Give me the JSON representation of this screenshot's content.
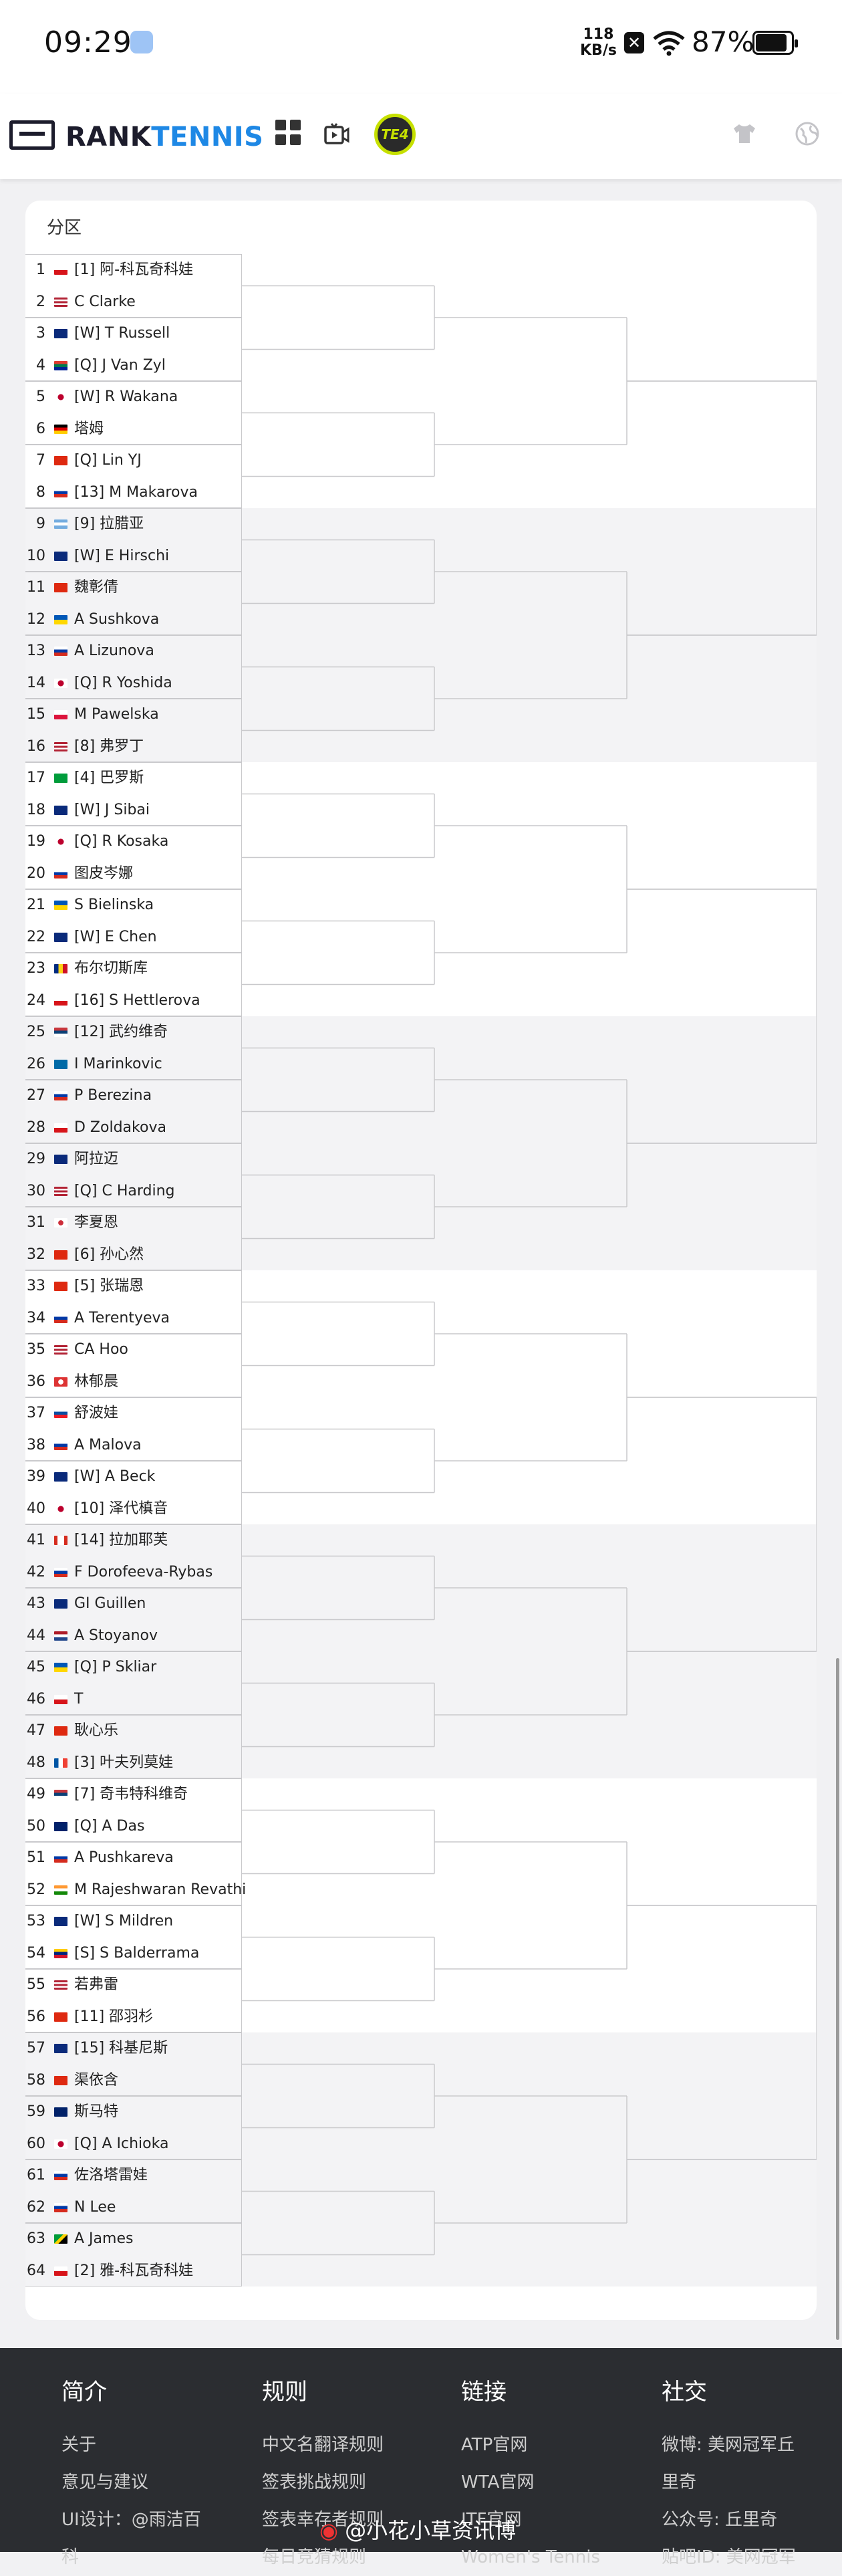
{
  "status_bar": {
    "time": "09:29",
    "net_speed": "118",
    "net_unit": "KB/s",
    "battery": "87%"
  },
  "header": {
    "logo_part1": "RANK",
    "logo_part2": "TENNIS",
    "badge": "TE4",
    "icons": [
      "draw-icon",
      "video-icon",
      "shirt-icon",
      "globe-icon"
    ]
  },
  "draw": {
    "section_label": "分区",
    "players": [
      {
        "num": "1",
        "flag": "cz",
        "name": "[1] 阿-科瓦奇科娃"
      },
      {
        "num": "2",
        "flag": "us",
        "name": "C Clarke"
      },
      {
        "num": "3",
        "flag": "au",
        "name": "[W] T Russell"
      },
      {
        "num": "4",
        "flag": "za",
        "name": "[Q] J Van Zyl"
      },
      {
        "num": "5",
        "flag": "jp",
        "name": "[W] R Wakana"
      },
      {
        "num": "6",
        "flag": "de",
        "name": "塔姆"
      },
      {
        "num": "7",
        "flag": "cn",
        "name": "[Q] Lin YJ"
      },
      {
        "num": "8",
        "flag": "ru",
        "name": "[13] M Makarova"
      },
      {
        "num": "9",
        "flag": "ar",
        "name": "[9] 拉腊亚"
      },
      {
        "num": "10",
        "flag": "au",
        "name": "[W] E Hirschi"
      },
      {
        "num": "11",
        "flag": "cn",
        "name": "魏彰倩"
      },
      {
        "num": "12",
        "flag": "ua",
        "name": "A Sushkova"
      },
      {
        "num": "13",
        "flag": "ru",
        "name": "A Lizunova"
      },
      {
        "num": "14",
        "flag": "jp",
        "name": "[Q] R Yoshida"
      },
      {
        "num": "15",
        "flag": "pl",
        "name": "M Pawelska"
      },
      {
        "num": "16",
        "flag": "us",
        "name": "[8] 弗罗丁"
      },
      {
        "num": "17",
        "flag": "br",
        "name": "[4] 巴罗斯"
      },
      {
        "num": "18",
        "flag": "au",
        "name": "[W] J Sibai"
      },
      {
        "num": "19",
        "flag": "jp",
        "name": "[Q] R Kosaka"
      },
      {
        "num": "20",
        "flag": "ru",
        "name": "图皮岑娜"
      },
      {
        "num": "21",
        "flag": "ua",
        "name": "S Bielinska"
      },
      {
        "num": "22",
        "flag": "au",
        "name": "[W] E Chen"
      },
      {
        "num": "23",
        "flag": "ro",
        "name": "布尔切斯库"
      },
      {
        "num": "24",
        "flag": "cz",
        "name": "[16] S Hettlerova"
      },
      {
        "num": "25",
        "flag": "rs",
        "name": "[12] 武约维奇"
      },
      {
        "num": "26",
        "flag": "se",
        "name": "I Marinkovic"
      },
      {
        "num": "27",
        "flag": "ru",
        "name": "P Berezina"
      },
      {
        "num": "28",
        "flag": "cz",
        "name": "D Zoldakova"
      },
      {
        "num": "29",
        "flag": "au",
        "name": "阿拉迈"
      },
      {
        "num": "30",
        "flag": "us",
        "name": "[Q] C Harding"
      },
      {
        "num": "31",
        "flag": "kr",
        "name": "李夏恩"
      },
      {
        "num": "32",
        "flag": "cn",
        "name": "[6] 孙心然"
      },
      {
        "num": "33",
        "flag": "cn",
        "name": "[5] 张瑞恩"
      },
      {
        "num": "34",
        "flag": "ru",
        "name": "A Terentyeva"
      },
      {
        "num": "35",
        "flag": "us",
        "name": "CA Hoo"
      },
      {
        "num": "36",
        "flag": "tw",
        "name": "林郁晨"
      },
      {
        "num": "37",
        "flag": "sk",
        "name": "舒波娃"
      },
      {
        "num": "38",
        "flag": "ru",
        "name": "A Malova"
      },
      {
        "num": "39",
        "flag": "au",
        "name": "[W] A Beck"
      },
      {
        "num": "40",
        "flag": "jp",
        "name": "[10] 泽代槙音"
      },
      {
        "num": "41",
        "flag": "ca",
        "name": "[14] 拉加耶芙"
      },
      {
        "num": "42",
        "flag": "ru",
        "name": "F Dorofeeva-Rybas"
      },
      {
        "num": "43",
        "flag": "au",
        "name": "GI Guillen"
      },
      {
        "num": "44",
        "flag": "nl",
        "name": "A Stoyanov"
      },
      {
        "num": "45",
        "flag": "ua",
        "name": "[Q] P Skliar"
      },
      {
        "num": "46",
        "flag": "cz",
        "name": "T"
      },
      {
        "num": "47",
        "flag": "cn",
        "name": "耿心乐"
      },
      {
        "num": "48",
        "flag": "fr",
        "name": "[3] 叶夫列莫娃"
      },
      {
        "num": "49",
        "flag": "rs",
        "name": "[7] 奇韦特科维奇"
      },
      {
        "num": "50",
        "flag": "nz",
        "name": "[Q] A Das"
      },
      {
        "num": "51",
        "flag": "ru",
        "name": "A Pushkareva"
      },
      {
        "num": "52",
        "flag": "in",
        "name": "M Rajeshwaran Revathi"
      },
      {
        "num": "53",
        "flag": "au",
        "name": "[W] S Mildren"
      },
      {
        "num": "54",
        "flag": "ve",
        "name": "[S] S Balderrama"
      },
      {
        "num": "55",
        "flag": "us",
        "name": "若弗雷"
      },
      {
        "num": "56",
        "flag": "cn",
        "name": "[11] 邵羽杉"
      },
      {
        "num": "57",
        "flag": "au",
        "name": "[15] 科基尼斯"
      },
      {
        "num": "58",
        "flag": "cn",
        "name": "渠依含"
      },
      {
        "num": "59",
        "flag": "gb",
        "name": "斯马特"
      },
      {
        "num": "60",
        "flag": "jp",
        "name": "[Q] A Ichioka"
      },
      {
        "num": "61",
        "flag": "ru",
        "name": "佐洛塔雷娃"
      },
      {
        "num": "62",
        "flag": "ru",
        "name": "N Lee"
      },
      {
        "num": "63",
        "flag": "jm",
        "name": "A James"
      },
      {
        "num": "64",
        "flag": "cz",
        "name": "[2] 雅-科瓦奇科娃"
      }
    ]
  },
  "footer": {
    "columns": [
      {
        "title": "简介",
        "items": [
          "关于",
          "意见与建议",
          "UI设计：@雨洁百",
          "科"
        ]
      },
      {
        "title": "规则",
        "items": [
          "中文名翻译规则",
          "签表挑战规则",
          "签表幸存者规则",
          "每日竞猜规则"
        ]
      },
      {
        "title": "链接",
        "items": [
          "ATP官网",
          "WTA官网",
          "ITF官网",
          "Women's Tennis"
        ]
      },
      {
        "title": "社交",
        "items": [
          "微博: 美网冠军丘",
          "里奇",
          "公众号: 丘里奇",
          "贴吧ID: 美网冠军"
        ]
      }
    ],
    "watermark": "@小花小草资讯博"
  },
  "colors": {
    "accent": "#1e88e5",
    "badge": "#c6e000",
    "footer_bg": "#2b2d31"
  }
}
